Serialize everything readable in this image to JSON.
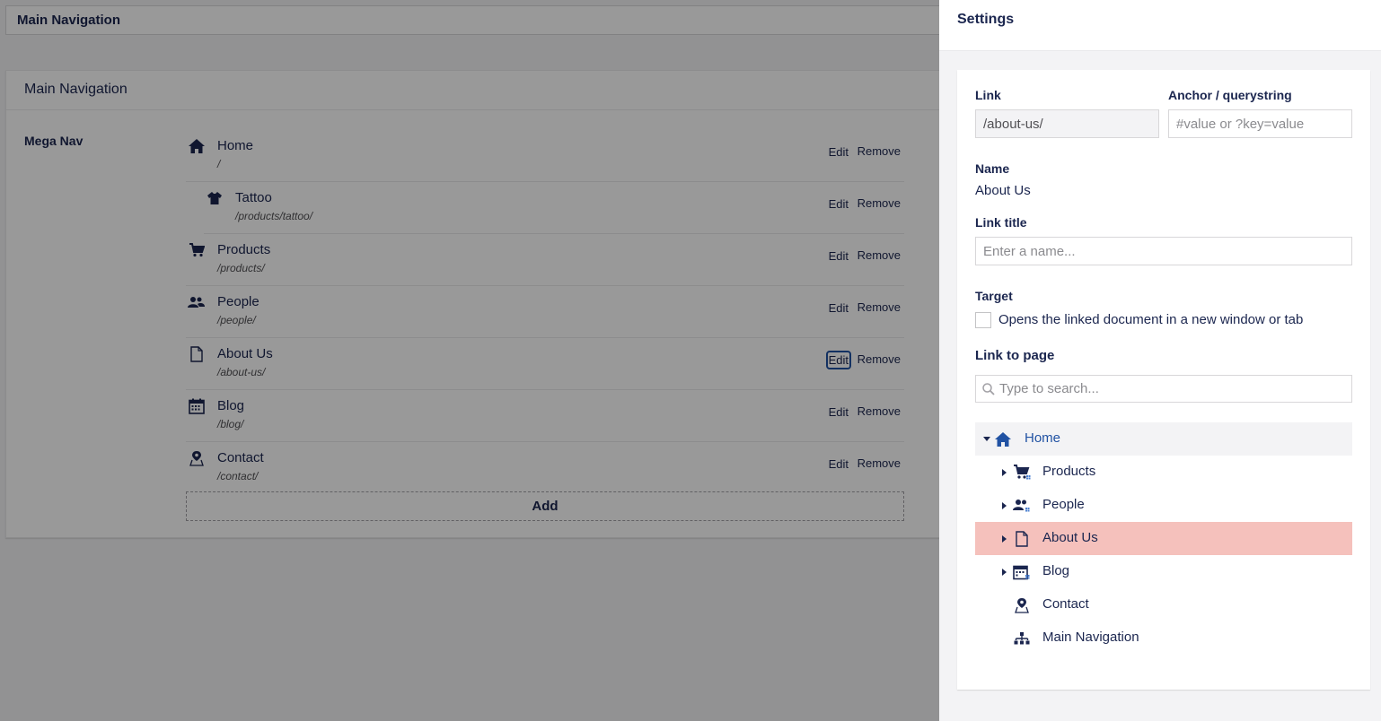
{
  "editor": {
    "name": "Main Navigation",
    "group_title": "Main Navigation",
    "property_label": "Mega Nav",
    "edit_label": "Edit",
    "remove_label": "Remove",
    "add_label": "Add",
    "items": [
      {
        "title": "Home",
        "url": "/",
        "icon": "home-icon"
      },
      {
        "title": "Tattoo",
        "url": "/products/tattoo/",
        "icon": "shirt-icon"
      },
      {
        "title": "Products",
        "url": "/products/",
        "icon": "cart-icon"
      },
      {
        "title": "People",
        "url": "/people/",
        "icon": "people-icon"
      },
      {
        "title": "About Us",
        "url": "/about-us/",
        "icon": "document-icon"
      },
      {
        "title": "Blog",
        "url": "/blog/",
        "icon": "calendar-icon"
      },
      {
        "title": "Contact",
        "url": "/contact/",
        "icon": "map-pin-icon"
      }
    ]
  },
  "settings": {
    "title": "Settings",
    "link_label": "Link",
    "link_value": "/about-us/",
    "anchor_label": "Anchor / querystring",
    "anchor_placeholder": "#value or ?key=value",
    "name_label": "Name",
    "name_value": "About Us",
    "link_title_label": "Link title",
    "link_title_placeholder": "Enter a name...",
    "target_label": "Target",
    "target_checkbox_label": "Opens the linked document in a new window or tab",
    "link_to_page_label": "Link to page",
    "search_placeholder": "Type to search...",
    "tree": [
      {
        "label": "Home",
        "icon": "home-icon"
      },
      {
        "label": "Products",
        "icon": "cart-icon"
      },
      {
        "label": "People",
        "icon": "people-icon"
      },
      {
        "label": "About Us",
        "icon": "document-icon"
      },
      {
        "label": "Blog",
        "icon": "calendar-icon"
      },
      {
        "label": "Contact",
        "icon": "map-pin-icon"
      },
      {
        "label": "Main Navigation",
        "icon": "sitemap-icon"
      }
    ]
  },
  "colors": {
    "text": "#1b264f",
    "link_blue": "#2152a3",
    "selected_row": "#f5c1bc",
    "overlay": "rgba(0,0,0,0.4)"
  }
}
